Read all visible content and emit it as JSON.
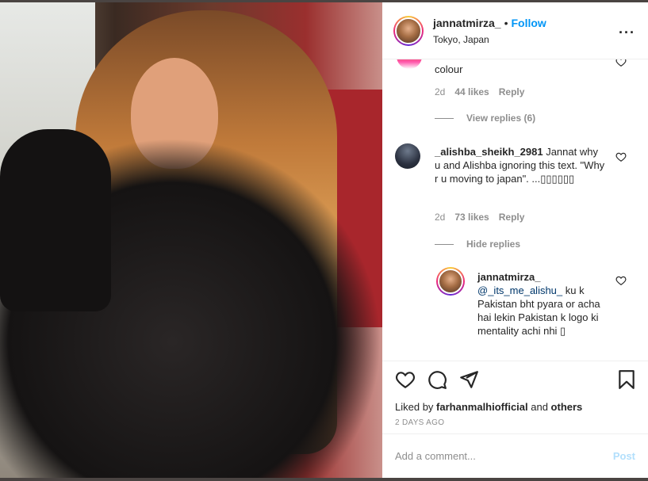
{
  "post": {
    "username": "jannatmirza_",
    "dot": "•",
    "follow_label": "Follow",
    "location": "Tokyo, Japan",
    "more_label": "..."
  },
  "comments": {
    "c1": {
      "text": "colour",
      "time": "2d",
      "likes": "44 likes",
      "reply": "Reply",
      "view_replies": "View replies (6)"
    },
    "c2": {
      "username": "_alishba_sheikh_2981",
      "text": " Jannat why u and Alishba ignoring this text. \"Why r u moving to japan\". ...▯▯▯▯▯▯",
      "time": "2d",
      "likes": "73 likes",
      "reply": "Reply",
      "hide_replies": "Hide replies"
    },
    "reply1": {
      "username": "jannatmirza_",
      "mention": "@_its_me_alishu_",
      "text": " ku k Pakistan bht pyara or acha hai lekin Pakistan k logo ki mentality achi nhi ▯"
    }
  },
  "footer": {
    "liked_prefix": "Liked by ",
    "liked_user": "farhanmalhiofficial",
    "liked_and": " and ",
    "liked_others": "others",
    "timestamp": "2 DAYS AGO",
    "comment_placeholder": "Add a comment...",
    "post_label": "Post"
  },
  "colors": {
    "link": "#0095f6",
    "text": "#262626",
    "muted": "#8e8e8e",
    "post_disabled": "#b2dffc"
  },
  "icons": [
    "heart-icon",
    "comment-icon",
    "share-icon",
    "bookmark-icon",
    "more-icon"
  ]
}
